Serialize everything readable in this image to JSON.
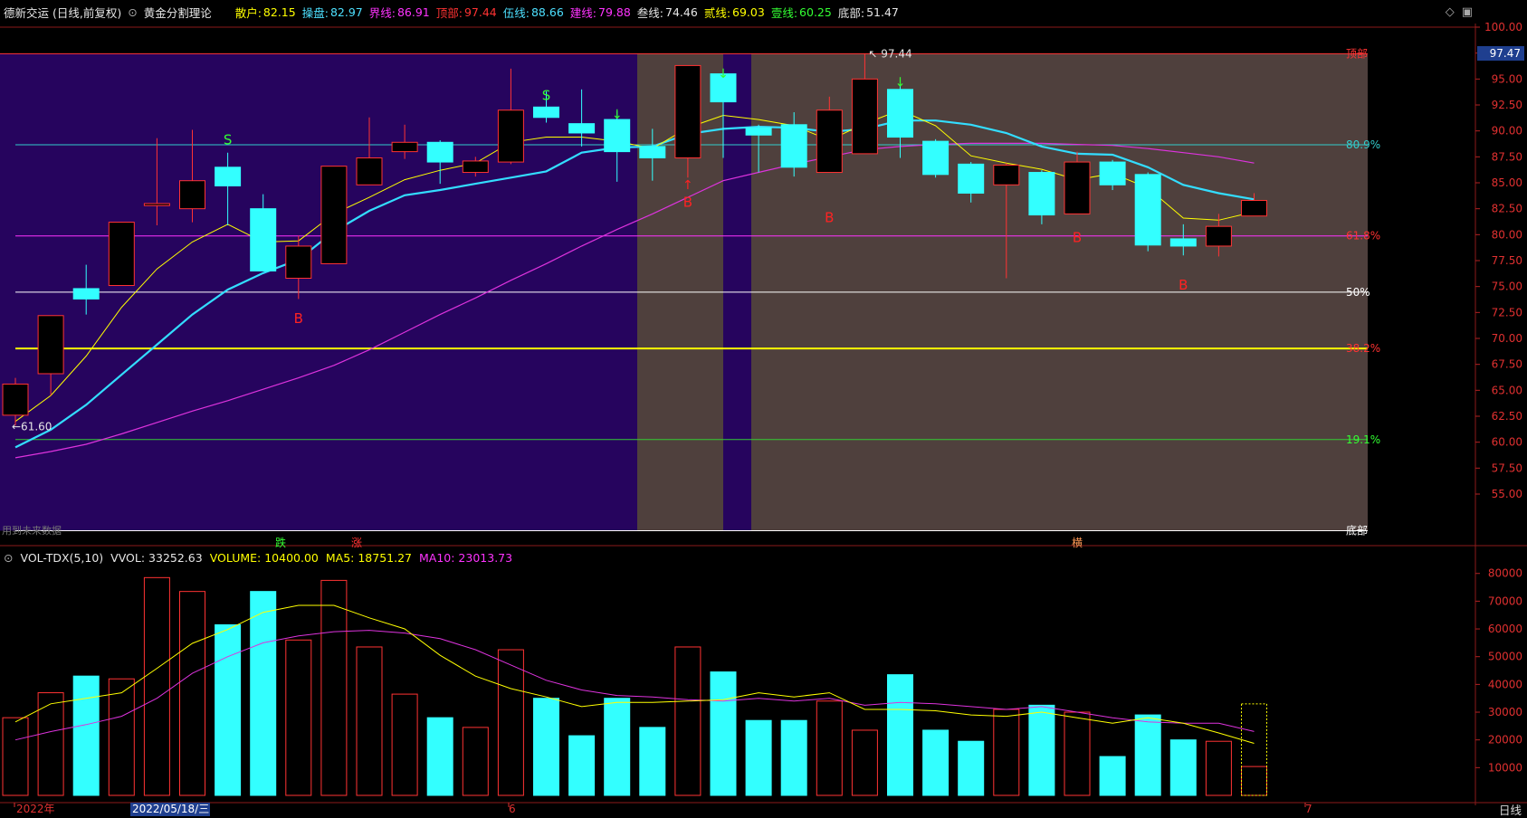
{
  "header": {
    "title": "德新交运 (日线,前复权)",
    "indicator": "黄金分割理论",
    "stats": [
      {
        "label": "散户:",
        "value": "82.15",
        "color": "#ffff00"
      },
      {
        "label": "操盘:",
        "value": "82.97",
        "color": "#4de0ff"
      },
      {
        "label": "界线:",
        "value": "86.91",
        "color": "#ff33ff"
      },
      {
        "label": "顶部:",
        "value": "97.44",
        "color": "#ff3333"
      },
      {
        "label": "伍线:",
        "value": "88.66",
        "color": "#4de0ff"
      },
      {
        "label": "建线:",
        "value": "79.88",
        "color": "#ff33ff"
      },
      {
        "label": "叁线:",
        "value": "74.46",
        "color": "#e6e6e6"
      },
      {
        "label": "贰线:",
        "value": "69.03",
        "color": "#ffff00"
      },
      {
        "label": "壹线:",
        "value": "60.25",
        "color": "#33ff33"
      },
      {
        "label": "底部:",
        "value": "51.47",
        "color": "#e6e6e6"
      }
    ]
  },
  "price_axis": {
    "ticks": [
      "100.00",
      "97.50",
      "95.00",
      "92.50",
      "90.00",
      "87.50",
      "85.00",
      "82.50",
      "80.00",
      "77.50",
      "75.00",
      "72.50",
      "70.00",
      "67.50",
      "65.00",
      "62.50",
      "60.00",
      "57.50",
      "55.00"
    ],
    "current": "97.47"
  },
  "levels": [
    {
      "label": "顶部",
      "value": 97.44,
      "color": "#ff3333",
      "labelColor": "#ff3333"
    },
    {
      "label": "80.9%",
      "value": 88.66,
      "color": "#33cccc",
      "labelColor": "#33cccc"
    },
    {
      "label": "61.8%",
      "value": 79.88,
      "color": "#ff33ff",
      "labelColor": "#ff3333"
    },
    {
      "label": "50%",
      "value": 74.46,
      "color": "#ffffff",
      "labelColor": "#ffffff"
    },
    {
      "label": "38.2%",
      "value": 69.03,
      "color": "#ffff00",
      "labelColor": "#ff3333"
    },
    {
      "label": "19.1%",
      "value": 60.25,
      "color": "#33cc33",
      "labelColor": "#33ff33"
    },
    {
      "label": "底部",
      "value": 51.47,
      "color": "#ffffff",
      "labelColor": "#ffffff"
    }
  ],
  "annotations": {
    "high_label": "97.44",
    "low_label": "61.60",
    "buy": "B",
    "sell": "S",
    "no_data": "用到未来数据",
    "die": "跌",
    "zhang": "涨",
    "pan": "横"
  },
  "volume": {
    "title": "VOL-TDX(5,10)",
    "vvol": "VVOL: 33252.63",
    "volume": "VOLUME: 10400.00",
    "ma5": "MA5: 18751.27",
    "ma10": "MA10: 23013.73",
    "ticks": [
      "80000",
      "70000",
      "60000",
      "50000",
      "40000",
      "30000",
      "20000",
      "10000"
    ]
  },
  "dates": {
    "d1": "2022年",
    "d2": "2022/05/18/三",
    "d3": "6",
    "d4": "7"
  },
  "colors": {
    "up": "#ff3333",
    "down": "#33ffff",
    "ma5": "#ffff00",
    "ma10": "#33ddff",
    "ma_long": "#dd33dd",
    "bg_purple": "#26045e",
    "bg_brown": "#4f403d"
  },
  "footer": {
    "period": "日线"
  },
  "chart_data": {
    "type": "candlestick",
    "candles": [
      {
        "o": 62.6,
        "c": 65.6,
        "h": 66.2,
        "l": 61.6
      },
      {
        "o": 66.6,
        "c": 72.2,
        "h": 72.2,
        "l": 64.5
      },
      {
        "o": 74.8,
        "c": 73.8,
        "h": 77.1,
        "l": 72.3
      },
      {
        "o": 75.1,
        "c": 81.2,
        "h": 81.2,
        "l": 75.1
      },
      {
        "o": 82.8,
        "c": 83.0,
        "h": 89.3,
        "l": 80.9
      },
      {
        "o": 82.5,
        "c": 85.2,
        "h": 90.1,
        "l": 81.2
      },
      {
        "o": 86.5,
        "c": 84.7,
        "h": 87.9,
        "l": 80.9
      },
      {
        "o": 82.5,
        "c": 76.5,
        "h": 83.9,
        "l": 76.5
      },
      {
        "o": 75.8,
        "c": 78.9,
        "h": 79.9,
        "l": 73.8
      },
      {
        "o": 77.2,
        "c": 86.6,
        "h": 86.6,
        "l": 77.2
      },
      {
        "o": 84.8,
        "c": 87.4,
        "h": 91.3,
        "l": 84.8
      },
      {
        "o": 88.0,
        "c": 88.9,
        "h": 90.6,
        "l": 87.3
      },
      {
        "o": 88.9,
        "c": 87.0,
        "h": 89.1,
        "l": 84.9
      },
      {
        "o": 86.0,
        "c": 87.1,
        "h": 87.5,
        "l": 85.6
      },
      {
        "o": 87.0,
        "c": 92.0,
        "h": 96.0,
        "l": 86.8
      },
      {
        "o": 92.3,
        "c": 91.3,
        "h": 93.8,
        "l": 90.8
      },
      {
        "o": 90.7,
        "c": 89.8,
        "h": 94.0,
        "l": 88.5
      },
      {
        "o": 91.1,
        "c": 88.0,
        "h": 91.9,
        "l": 85.1
      },
      {
        "o": 88.5,
        "c": 87.4,
        "h": 90.2,
        "l": 85.2
      },
      {
        "o": 87.4,
        "c": 96.3,
        "h": 96.3,
        "l": 85.5
      },
      {
        "o": 95.5,
        "c": 92.8,
        "h": 95.8,
        "l": 87.4
      },
      {
        "o": 90.3,
        "c": 89.6,
        "h": 90.6,
        "l": 86.0
      },
      {
        "o": 90.6,
        "c": 86.5,
        "h": 91.8,
        "l": 85.6
      },
      {
        "o": 86.0,
        "c": 92.0,
        "h": 93.3,
        "l": 86.0
      },
      {
        "o": 87.8,
        "c": 95.0,
        "h": 97.44,
        "l": 87.8
      },
      {
        "o": 94.0,
        "c": 89.4,
        "h": 95.0,
        "l": 87.4
      },
      {
        "o": 89.0,
        "c": 85.8,
        "h": 89.2,
        "l": 85.5
      },
      {
        "o": 86.8,
        "c": 84.0,
        "h": 87.0,
        "l": 83.1
      },
      {
        "o": 84.8,
        "c": 86.7,
        "h": 86.9,
        "l": 75.8
      },
      {
        "o": 86.0,
        "c": 81.9,
        "h": 86.2,
        "l": 81.0
      },
      {
        "o": 82.0,
        "c": 87.0,
        "h": 88.0,
        "l": 82.0
      },
      {
        "o": 87.0,
        "c": 84.8,
        "h": 87.2,
        "l": 84.3
      },
      {
        "o": 85.8,
        "c": 79.0,
        "h": 86.0,
        "l": 78.4
      },
      {
        "o": 79.6,
        "c": 78.9,
        "h": 81.0,
        "l": 78.0
      },
      {
        "o": 78.9,
        "c": 80.8,
        "h": 82.0,
        "l": 77.9
      },
      {
        "o": 81.8,
        "c": 83.3,
        "h": 84.0,
        "l": 81.8
      }
    ],
    "ma5": [
      62.0,
      64.5,
      68.3,
      73.0,
      76.7,
      79.3,
      81.0,
      79.3,
      79.4,
      82.0,
      83.6,
      85.3,
      86.2,
      86.9,
      88.9,
      89.4,
      89.4,
      89.0,
      88.3,
      90.3,
      91.5,
      91.1,
      90.5,
      89.1,
      90.7,
      92.0,
      90.5,
      87.6,
      86.9,
      86.3,
      85.3,
      85.9,
      84.5,
      81.6,
      81.4,
      82.2
    ],
    "ma10": [
      59.5,
      61.2,
      63.6,
      66.5,
      69.4,
      72.3,
      74.7,
      76.3,
      77.6,
      80.3,
      82.3,
      83.8,
      84.3,
      84.9,
      85.5,
      86.1,
      87.9,
      88.4,
      88.5,
      89.7,
      90.2,
      90.4,
      90.3,
      89.9,
      90.2,
      91.0,
      91.0,
      90.6,
      89.8,
      88.5,
      87.8,
      87.7,
      86.5,
      84.8,
      84.0,
      83.4
    ],
    "ma_long": [
      58.5,
      59.1,
      59.8,
      60.8,
      61.9,
      63.0,
      64.0,
      65.1,
      66.2,
      67.4,
      68.9,
      70.6,
      72.3,
      73.9,
      75.6,
      77.2,
      78.9,
      80.5,
      82.0,
      83.6,
      85.2,
      86.0,
      86.8,
      87.5,
      88.2,
      88.5,
      88.7,
      88.8,
      88.8,
      88.8,
      88.7,
      88.6,
      88.3,
      87.9,
      87.5,
      86.9
    ],
    "volume": [
      28000,
      37000,
      43000,
      42000,
      78500,
      73500,
      61500,
      73500,
      56000,
      77500,
      53500,
      36500,
      28000,
      24500,
      52500,
      35000,
      21500,
      35000,
      24500,
      53500,
      44500,
      27000,
      27000,
      34000,
      23500,
      43500,
      23500,
      19500,
      31000,
      32500,
      30000,
      14000,
      29000,
      20000,
      19500,
      10400
    ],
    "vol_ma5": [
      26500,
      33000,
      35000,
      37000,
      45800,
      54800,
      59800,
      66000,
      68500,
      68500,
      64000,
      60000,
      50500,
      43000,
      38500,
      35500,
      32000,
      33500,
      33500,
      34000,
      34500,
      37000,
      35500,
      37000,
      31000,
      31000,
      30500,
      29000,
      28500,
      30000,
      28000,
      26000,
      28000,
      26000,
      22500,
      18751
    ],
    "vol_ma10": [
      20000,
      23000,
      25500,
      28500,
      35000,
      44000,
      50000,
      55000,
      57500,
      59000,
      59500,
      58500,
      56500,
      52500,
      47000,
      41500,
      38000,
      36000,
      35500,
      34500,
      34000,
      35000,
      34000,
      35000,
      32500,
      33500,
      33000,
      32000,
      31000,
      32000,
      30000,
      28000,
      26500,
      26000,
      26000,
      23013
    ]
  }
}
